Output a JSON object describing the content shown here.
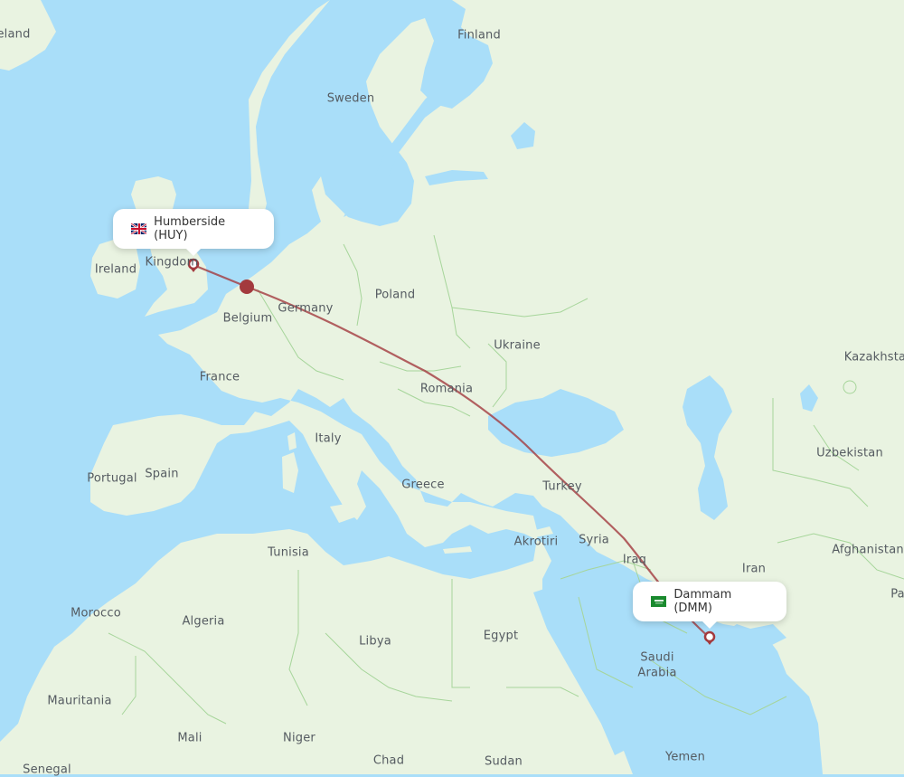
{
  "map": {
    "route": {
      "origin": {
        "name": "Humberside",
        "code": "HUY",
        "label": "Humberside (HUY)",
        "flag": "uk-flag"
      },
      "destination": {
        "name": "Dammam",
        "code": "DMM",
        "label": "Dammam (DMM)",
        "flag": "saudi-arabia-flag"
      },
      "color": "#a33a3e"
    },
    "colors": {
      "water": "#a9def9",
      "land": "#e9f3e1",
      "border": "#a6d59a",
      "label": "#555b61"
    },
    "labels": [
      {
        "id": "iceland",
        "text": "eland"
      },
      {
        "id": "finland",
        "text": "Finland"
      },
      {
        "id": "sweden",
        "text": "Sweden"
      },
      {
        "id": "kingdom",
        "text": "Kingdom"
      },
      {
        "id": "ireland",
        "text": "Ireland"
      },
      {
        "id": "poland",
        "text": "Poland"
      },
      {
        "id": "germany",
        "text": "Germany"
      },
      {
        "id": "belgium",
        "text": "Belgium"
      },
      {
        "id": "ukraine",
        "text": "Ukraine"
      },
      {
        "id": "kazakhstan",
        "text": "Kazakhsta"
      },
      {
        "id": "france",
        "text": "France"
      },
      {
        "id": "romania",
        "text": "Romania"
      },
      {
        "id": "italy",
        "text": "Italy"
      },
      {
        "id": "uzbekistan",
        "text": "Uzbekistan"
      },
      {
        "id": "portugal",
        "text": "Portugal"
      },
      {
        "id": "spain",
        "text": "Spain"
      },
      {
        "id": "greece",
        "text": "Greece"
      },
      {
        "id": "turkey",
        "text": "Turkey"
      },
      {
        "id": "tunisia",
        "text": "Tunisia"
      },
      {
        "id": "akrotiri",
        "text": "Akrotiri"
      },
      {
        "id": "syria",
        "text": "Syria"
      },
      {
        "id": "afghanistan",
        "text": "Afghanistan"
      },
      {
        "id": "iraq",
        "text": "Iraq"
      },
      {
        "id": "iran",
        "text": "Iran"
      },
      {
        "id": "pakistan",
        "text": "Pa"
      },
      {
        "id": "morocco",
        "text": "Morocco"
      },
      {
        "id": "algeria",
        "text": "Algeria"
      },
      {
        "id": "libya",
        "text": "Libya"
      },
      {
        "id": "egypt",
        "text": "Egypt"
      },
      {
        "id": "saudi",
        "text": "Saudi"
      },
      {
        "id": "arabia",
        "text": "Arabia"
      },
      {
        "id": "mauritania",
        "text": "Mauritania"
      },
      {
        "id": "mali",
        "text": "Mali"
      },
      {
        "id": "niger",
        "text": "Niger"
      },
      {
        "id": "chad",
        "text": "Chad"
      },
      {
        "id": "sudan",
        "text": "Sudan"
      },
      {
        "id": "yemen",
        "text": "Yemen"
      },
      {
        "id": "senegal",
        "text": "Senegal"
      }
    ]
  }
}
